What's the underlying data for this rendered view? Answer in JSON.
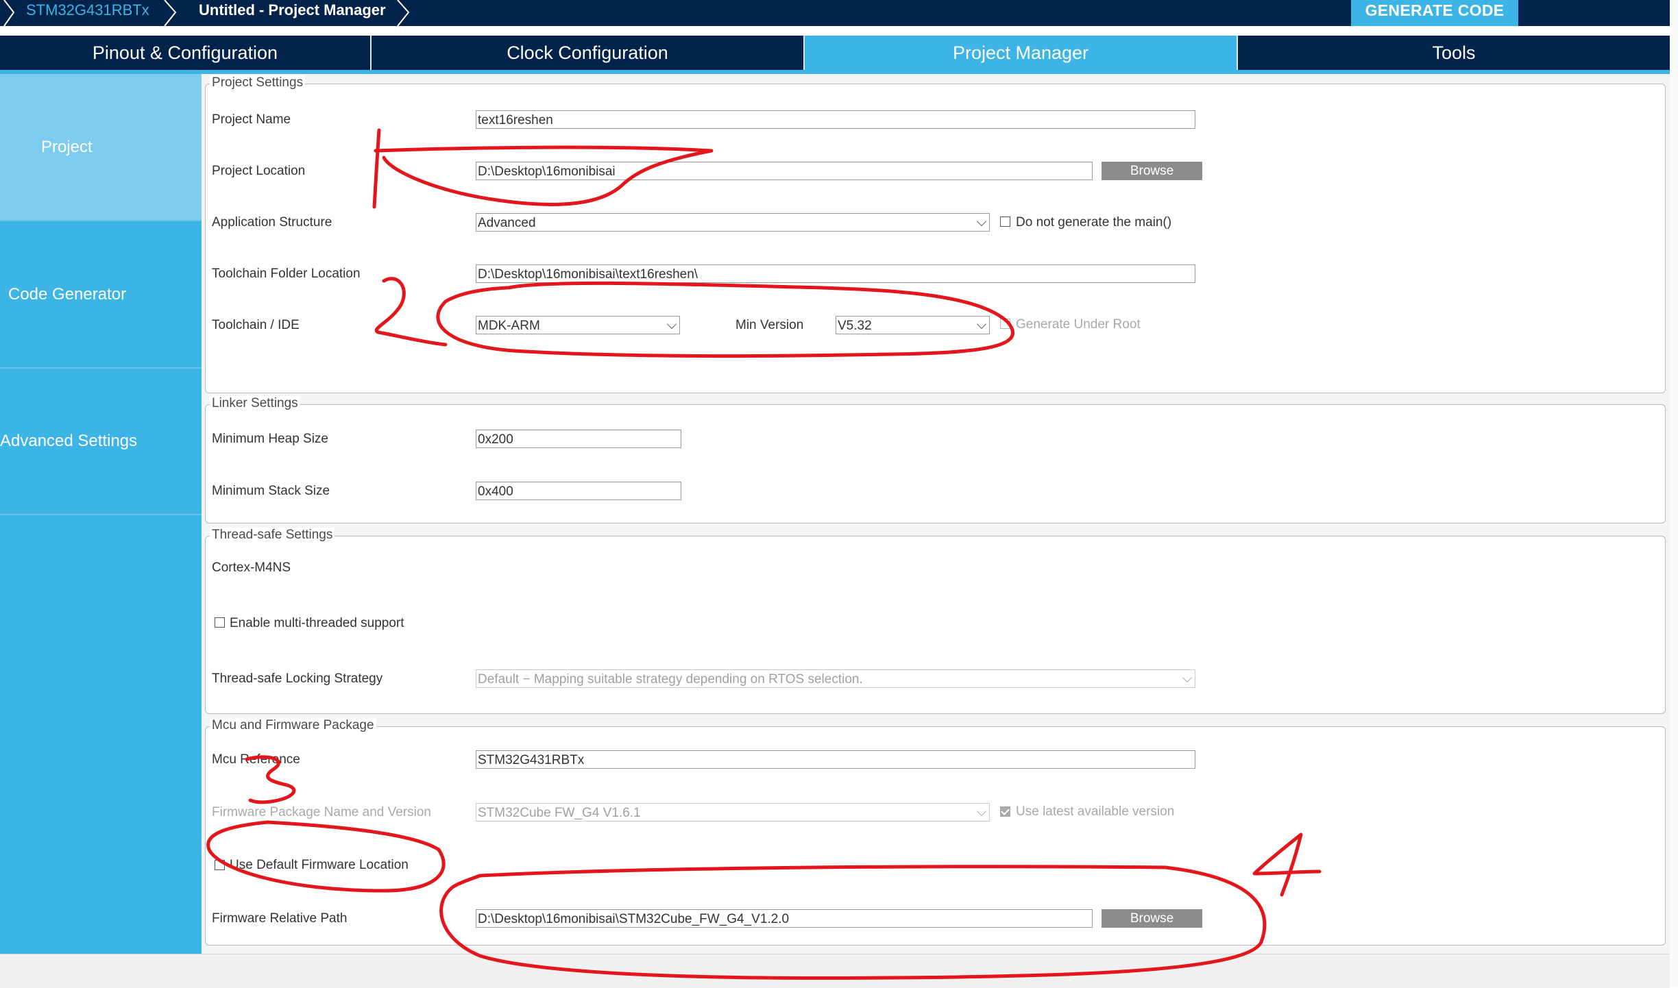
{
  "breadcrumb": {
    "device": "STM32G431RBTx",
    "project": "Untitled - Project Manager"
  },
  "generate_code_label": "GENERATE CODE",
  "tabs": [
    {
      "label": "Pinout & Configuration",
      "active": false
    },
    {
      "label": "Clock Configuration",
      "active": false
    },
    {
      "label": "Project Manager",
      "active": true
    },
    {
      "label": "Tools",
      "active": false
    }
  ],
  "sidebar": {
    "items": [
      {
        "label": "Project",
        "active": true
      },
      {
        "label": "Code Generator",
        "active": false
      },
      {
        "label": "Advanced Settings",
        "active": false
      }
    ]
  },
  "project_settings": {
    "legend": "Project Settings",
    "project_name": {
      "label": "Project Name",
      "value": "text16reshen"
    },
    "project_location": {
      "label": "Project Location",
      "value": "D:\\Desktop\\16monibisai",
      "browse_label": "Browse"
    },
    "application_structure": {
      "label": "Application Structure",
      "value": "Advanced",
      "checkbox_label": "Do not generate the main()",
      "checked": false
    },
    "toolchain_folder": {
      "label": "Toolchain Folder Location",
      "value": "D:\\Desktop\\16monibisai\\text16reshen\\"
    },
    "toolchain_ide": {
      "label": "Toolchain / IDE",
      "value": "MDK-ARM",
      "min_version_label": "Min Version",
      "min_version_value": "V5.32",
      "generate_under_root_label": "Generate Under Root",
      "generate_under_root_checked": false
    }
  },
  "linker_settings": {
    "legend": "Linker Settings",
    "min_heap": {
      "label": "Minimum Heap Size",
      "value": "0x200"
    },
    "min_stack": {
      "label": "Minimum Stack Size",
      "value": "0x400"
    }
  },
  "thread_safe": {
    "legend": "Thread-safe Settings",
    "core": "Cortex-M4NS",
    "multi_thread_label": "Enable multi-threaded support",
    "multi_thread_checked": false,
    "locking_label": "Thread-safe Locking Strategy",
    "locking_value": "Default  −  Mapping suitable strategy depending on RTOS selection."
  },
  "mcu_firmware": {
    "legend": "Mcu and Firmware Package",
    "mcu_reference": {
      "label": "Mcu Reference",
      "value": "STM32G431RBTx"
    },
    "firmware_package": {
      "label": "Firmware Package Name and Version",
      "value": "STM32Cube FW_G4 V1.6.1",
      "latest_label": "Use latest available version",
      "latest_checked": true
    },
    "default_location": {
      "label": "Use Default Firmware Location",
      "checked": false
    },
    "relative_path": {
      "label": "Firmware Relative Path",
      "value": "D:\\Desktop\\16monibisai\\STM32Cube_FW_G4_V1.2.0",
      "browse_label": "Browse"
    }
  },
  "colors": {
    "navy": "#03234b",
    "accent": "#3cb4e6",
    "sidebar_active": "#7dccef",
    "annotation": "#e3161b"
  }
}
